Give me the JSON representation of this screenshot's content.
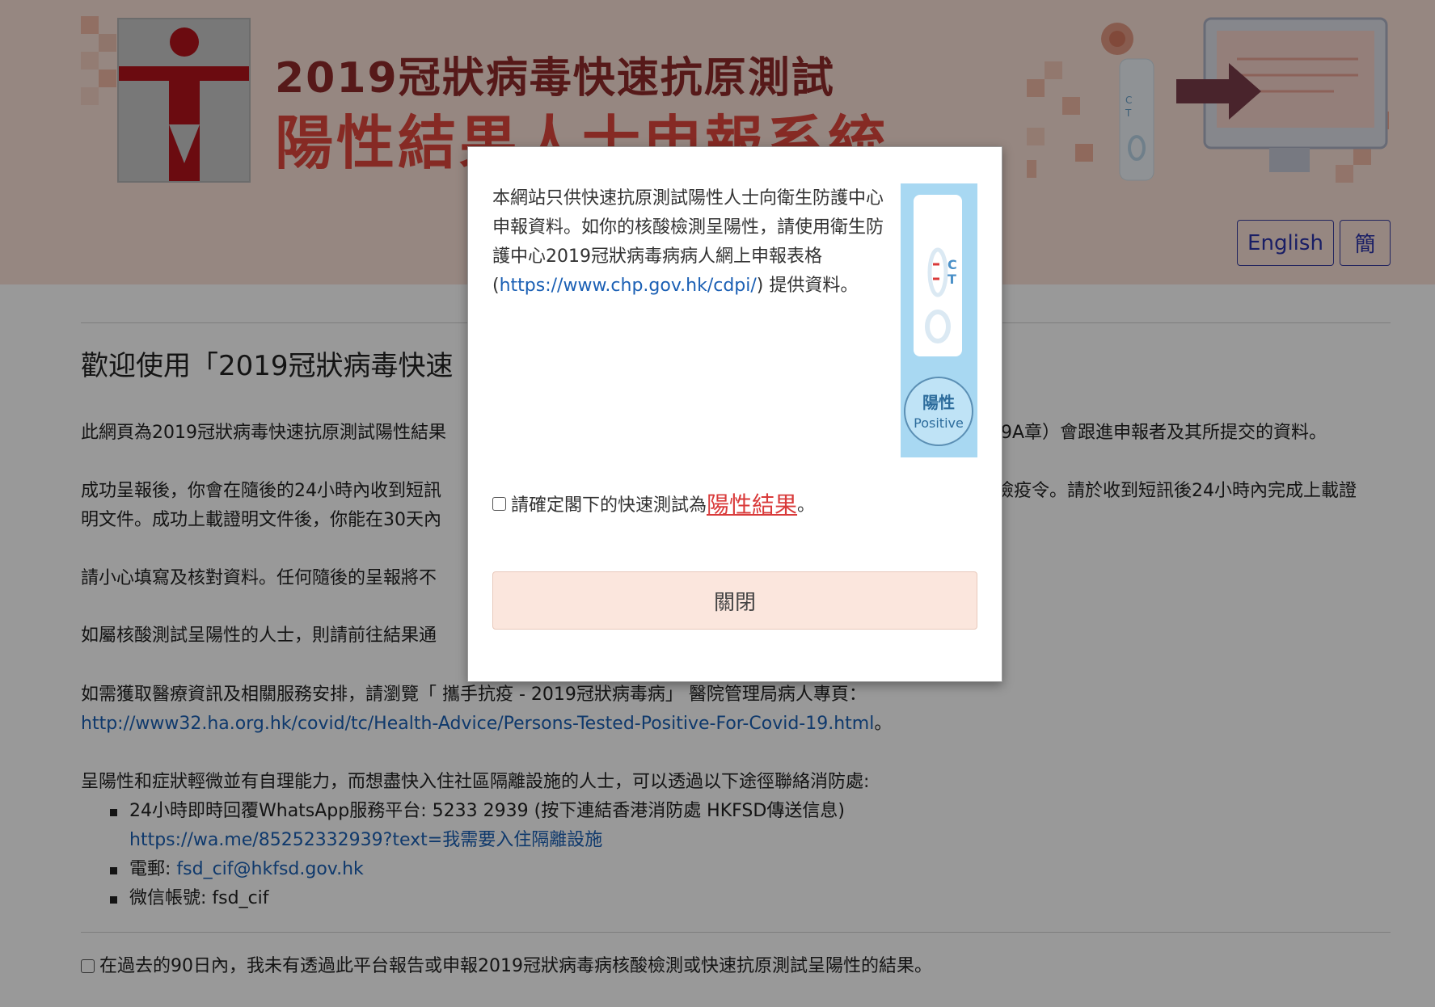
{
  "banner": {
    "title_line1": "2019冠狀病毒快速抗原測試",
    "title_line2": "陽性結果人士申報系統"
  },
  "lang": {
    "english": "English",
    "simplified": "簡"
  },
  "content": {
    "welcome_partial": "歡迎使用「2019冠狀病毒快速",
    "para1_left": "此網頁為2019冠狀病毒快速抗原測試陽性結果",
    "para1_right": "9A章）會跟進申報者及其所提交的資料。",
    "para2_line1_left": "成功呈報後，你會在隨後的24小時內收到短訊",
    "para2_line1_right": "檢疫令。請於收到短訊後24小時內完成上載證",
    "para2_line2_left": "明文件。成功上載證明文件後，你能在30天內",
    "para3_left": "請小心填寫及核對資料。任何隨後的呈報將不",
    "para4_left": "如屬核酸測試呈陽性的人士，則請前往結果通",
    "para5_line1": "如需獲取醫療資訊及相關服務安排，請瀏覽「 攜手抗疫 - 2019冠狀病毒病」 醫院管理局病人專頁：",
    "para5_link": "http://www32.ha.org.hk/covid/tc/Health-Advice/Persons-Tested-Positive-For-Covid-19.html",
    "para5_end": "。",
    "para6": "呈陽性和症狀輕微並有自理能力，而想盡快入住社區隔離設施的人士，可以透過以下途徑聯絡消防處:",
    "fsd_whatsapp": "24小時即時回覆WhatsApp服務平台: 5233 2939 (按下連結香港消防處 HKFSD傳送信息)",
    "fsd_whatsapp_link": "https://wa.me/85252332939?text=我需要入住隔離設施",
    "fsd_email_label": "電郵: ",
    "fsd_email": "fsd_cif@hkfsd.gov.hk",
    "fsd_wechat": "微信帳號: fsd_cif",
    "declaration": "在過去的90日內，我未有透過此平台報告或申報2019冠狀病毒病核酸檢測或快速抗原測試呈陽性的結果。"
  },
  "modal": {
    "text_before_link": "本網站只供快速抗原測試陽性人士向衛生防護中心申報資料。如你的核酸檢測呈陽性，請使用衛生防護中心2019冠狀病毒病病人網上申報表格 (",
    "link": "https://www.chp.gov.hk/cdpi/",
    "text_after_link": ") 提供資料。",
    "test_label_c": "C",
    "test_label_t": "T",
    "badge_zh": "陽性",
    "badge_en": "Positive",
    "confirm_before": "請確定閣下的快速測試為",
    "confirm_red": "陽性結果",
    "confirm_after": "。",
    "close": "關閉"
  },
  "colors": {
    "header_bg": "#fbe2d8",
    "accent_red": "#e0473c",
    "lang_border": "#3a3f9e",
    "link": "#1a5fb4",
    "close_bg": "#fbe6dd"
  }
}
